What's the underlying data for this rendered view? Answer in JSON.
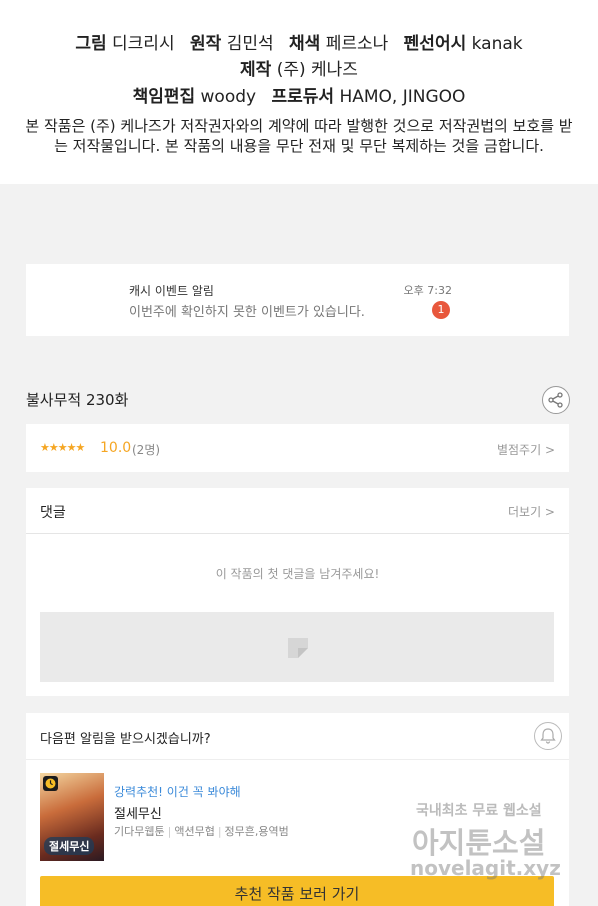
{
  "credits": {
    "line1": [
      {
        "role": "그림",
        "name": "디크리시"
      },
      {
        "role": "원작",
        "name": "김민석"
      },
      {
        "role": "채색",
        "name": "페르소나"
      },
      {
        "role": "펜선어시",
        "name": "kanak"
      }
    ],
    "line2": [
      {
        "role": "제작",
        "name": "(주) 케나즈"
      }
    ],
    "line3": [
      {
        "role": "책임편집",
        "name": "woody"
      },
      {
        "role": "프로듀서",
        "name": "HAMO, JINGOO"
      }
    ],
    "notice": "본 작품은 (주) 케나즈가 저작권자와의 계약에 따라 발행한 것으로 저작권법의 보호를 받는 저작물입니다. 본 작품의 내용을 무단 전재 및 무단 복제하는 것을 금합니다."
  },
  "event": {
    "title": "캐시 이벤트 알림",
    "description": "이번주에 확인하지 못한 이벤트가 있습니다.",
    "time": "오후 7:32",
    "badge": "1"
  },
  "episode": {
    "title": "불사무적 230화"
  },
  "rating": {
    "stars": "★★★★★",
    "score": "10.0",
    "count": "(2명)",
    "rate_link": "별점주기 >"
  },
  "comments": {
    "title": "댓글",
    "more": "더보기 >",
    "empty": "이 작품의 첫 댓글을 남겨주세요!"
  },
  "next": {
    "question": "다음편 알림을 받으시겠습니까?",
    "rec_tag": "강력추천! 이건 꼭 봐야해",
    "rec_title": "절세무신",
    "thumb_title": "절세무신",
    "meta": [
      "기다무웹툰",
      "액션무협",
      "정무흔,용역범"
    ],
    "cta": "추천 작품 보러 가기"
  },
  "watermark": {
    "line1": "국내최초 무료 웹소설",
    "line2": "아지툰소설",
    "line3": "novelagit.xyz"
  },
  "colors": {
    "accent_yellow": "#f6bd26",
    "star_orange": "#f5a623",
    "badge_red": "#e8573c",
    "link_blue": "#3b8ad9"
  }
}
